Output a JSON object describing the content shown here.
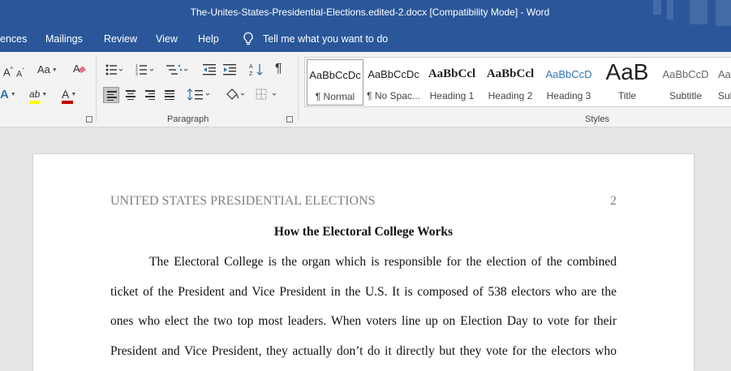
{
  "window": {
    "title": "The-Unites-States-Presidential-Elections.edited-2.docx [Compatibility Mode]  -  Word"
  },
  "tabs": [
    "ences",
    "Mailings",
    "Review",
    "View",
    "Help"
  ],
  "tell_me": {
    "text": "Tell me what you want to do",
    "icon": "lightbulb-icon"
  },
  "ribbon": {
    "font_group": {
      "grow_font": "A",
      "shrink_font": "A",
      "change_case": "Aa",
      "text_effects": "A",
      "highlight": "ab",
      "font_color": "A",
      "highlight_color": "#ffff00",
      "font_color_value": "#c00000"
    },
    "paragraph_group": {
      "label": "Paragraph",
      "show_marks": "¶"
    },
    "styles_group": {
      "label": "Styles",
      "items": [
        {
          "sample": "AaBbCcDc",
          "name": "¶ Normal"
        },
        {
          "sample": "AaBbCcDc",
          "name": "¶ No Spac..."
        },
        {
          "sample": "AaBbCcl",
          "name": "Heading 1"
        },
        {
          "sample": "AaBbCcl",
          "name": "Heading 2"
        },
        {
          "sample": "AaBbCcD",
          "name": "Heading 3"
        },
        {
          "sample": "AaB",
          "name": "Title"
        },
        {
          "sample": "AaBbCcD",
          "name": "Subtitle"
        },
        {
          "sample": "Aa",
          "name": "Sub"
        }
      ]
    }
  },
  "document": {
    "header_text": "UNITED STATES PRESIDENTIAL ELECTIONS",
    "page_number": "2",
    "heading": "How the Electoral College Works",
    "lines": [
      "The Electoral College is the organ which is responsible for the election of the combined",
      "ticket of the President and Vice President in the U.S. It is composed of 538 electors who are the",
      "ones who elect the two top most leaders. When voters line up on Election Day to vote for their",
      "President and Vice President, they actually don’t do it directly but they vote for the electors who"
    ]
  },
  "colors": {
    "titlebar": "#2b579a",
    "ribbon": "#f3f3f3",
    "canvas": "#e6e6e6",
    "heading_blue": "#2e74b5"
  }
}
